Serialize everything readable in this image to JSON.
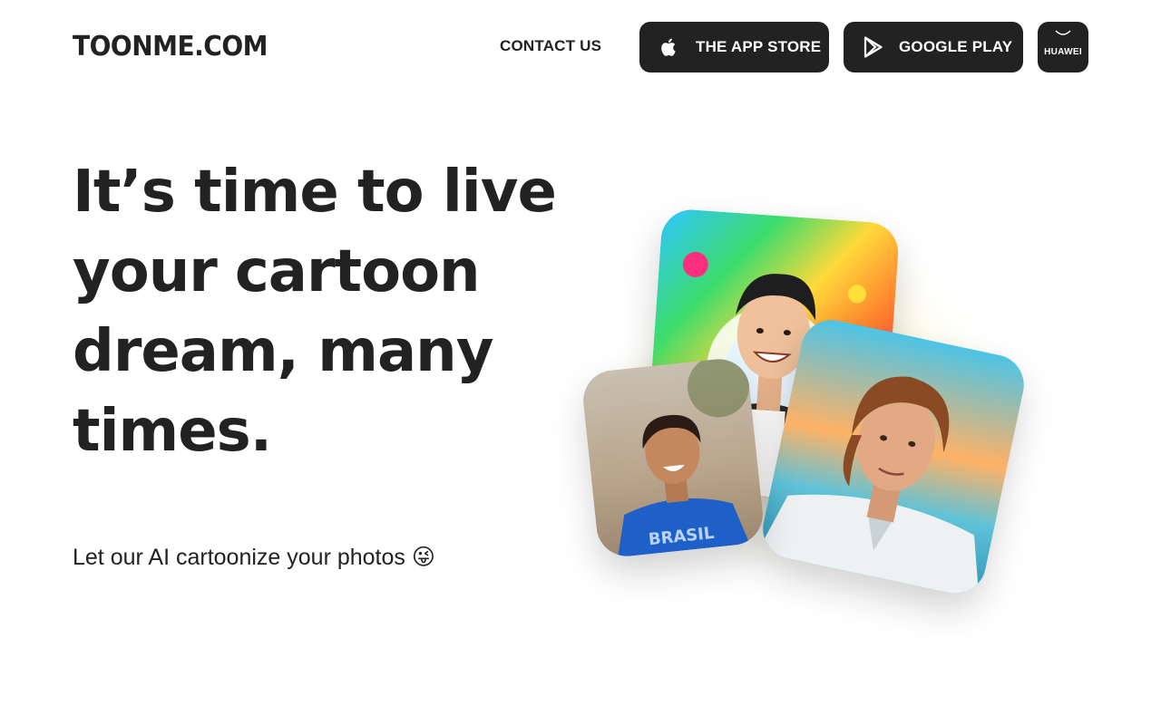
{
  "header": {
    "logo": "TOONME.COM",
    "contact_label": "CONTACT US",
    "app_store_label": "THE APP STORE",
    "google_play_label": "GOOGLE PLAY",
    "huawei_label": "HUAWEI"
  },
  "hero": {
    "headline_line1": "It’s time to live",
    "headline_line2_prefix": "your",
    "headline_highlight": "cartoon",
    "headline_line3": "dream, many",
    "headline_line4": "times.",
    "subline": "Let our AI cartoonize your photos",
    "subline_emoji": "😜"
  },
  "colors": {
    "highlight": "#6bfb72",
    "button_bg": "#222222",
    "text": "#222222",
    "glow": "#fff88c"
  },
  "icons": [
    "apple-icon",
    "google-play-icon",
    "huawei-icon"
  ]
}
